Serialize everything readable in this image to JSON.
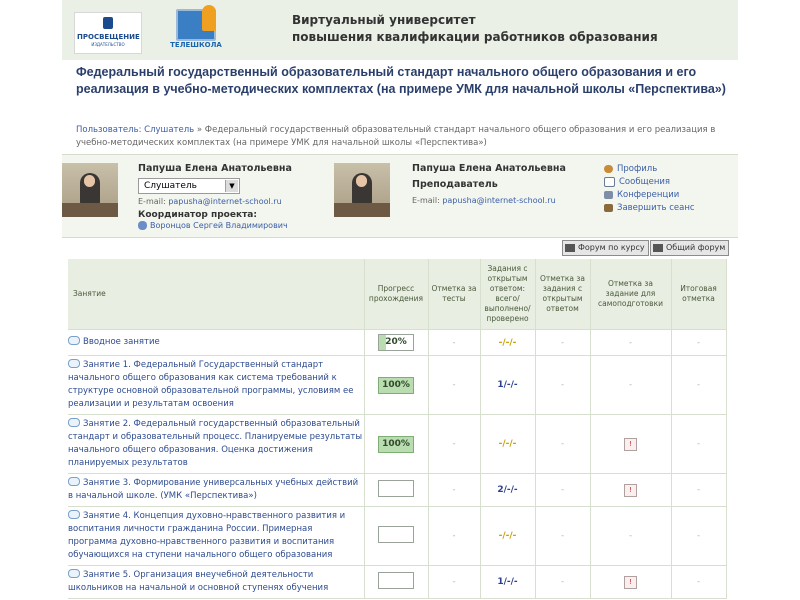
{
  "header": {
    "logo_prosveshchenie": "ПРОСВЕЩЕНИЕ",
    "logo_prosveshchenie_sub": "ИЗДАТЕЛЬСТВО",
    "logo_teleshkola": "ТЕЛЕШКОЛА",
    "university_line1": "Виртуальный университет",
    "university_line2": "повышения квалификации работников образования"
  },
  "course": {
    "title": "Федеральный государственный образовательный стандарт начального общего образования и его реализация в учебно-методических комплектах (на примере УМК для начальной школы «Перспектива»)"
  },
  "breadcrumb": {
    "user_link": "Пользователь: Слушатель",
    "separator": " » ",
    "rest": "Федеральный государственный образовательный стандарт начального общего образования и его реализация в учебно-методических комплектах (на примере УМК для начальной школы «Перспектива»)"
  },
  "student": {
    "name": "Папуша Елена Анатольевна",
    "role_selected": "Слушатель",
    "email_label": "E-mail:",
    "email": "papusha@internet-school.ru",
    "coordinator_label": "Координатор проекта:",
    "coordinator_name": "Воронцов Сергей Владимирович"
  },
  "teacher": {
    "name": "Папуша Елена Анатольевна",
    "role": "Преподаватель",
    "email_label": "E-mail:",
    "email": "papusha@internet-school.ru"
  },
  "menu": {
    "profile": "Профиль",
    "messages": "Сообщения",
    "conferences": "Конференции",
    "logout": "Завершить сеанс"
  },
  "forum": {
    "course_forum": "Форум по курсу",
    "general_forum": "Общий форум"
  },
  "table": {
    "headers": {
      "lesson": "Занятие",
      "progress": "Прогресс прохождения",
      "tests": "Отметка за тесты",
      "open_tasks": "Задания с открытым ответом: всего/ выполнено/ проверено",
      "open_mark": "Отметка за задания с открытым ответом",
      "self_mark": "Отметка за задание для самоподготовки",
      "total": "Итоговая отметка"
    },
    "rows": [
      {
        "title": "Вводное занятие",
        "progress": "20%",
        "tests": "-",
        "open": "-/-/-",
        "open_mark": "-",
        "self_mark": "-",
        "total": "-"
      },
      {
        "title": "Занятие 1. Федеральный Государственный стандарт начального общего образования как система требований к структуре основной образовательной программы, условиям ее реализации и результатам освоения",
        "progress": "100%",
        "tests": "-",
        "open": "1/-/-",
        "open_mark": "-",
        "self_mark": "-",
        "total": "-"
      },
      {
        "title": "Занятие 2. Федеральный государственный образовательный стандарт и образовательный процесс. Планируемые результаты начального общего образования. Оценка достижения планируемых результатов",
        "progress": "100%",
        "tests": "-",
        "open": "-/-/-",
        "open_mark": "-",
        "self_mark": "!",
        "total": "-"
      },
      {
        "title": "Занятие 3. Формирование универсальных учебных действий в начальной школе. (УМК «Перспектива»)",
        "progress": "",
        "tests": "-",
        "open": "2/-/-",
        "open_mark": "-",
        "self_mark": "!",
        "total": "-"
      },
      {
        "title": "Занятие 4. Концепция духовно-нравственного развития и воспитания личности гражданина России. Примерная программа духовно-нравственного развития и воспитания обучающихся на ступени начального общего образования",
        "progress": "",
        "tests": "-",
        "open": "-/-/-",
        "open_mark": "-",
        "self_mark": "-",
        "total": "-"
      },
      {
        "title": "Занятие 5. Организация внеучебной деятельности школьников на начальной и основной ступенях обучения",
        "progress": "",
        "tests": "-",
        "open": "1/-/-",
        "open_mark": "-",
        "self_mark": "!",
        "total": "-"
      }
    ]
  }
}
